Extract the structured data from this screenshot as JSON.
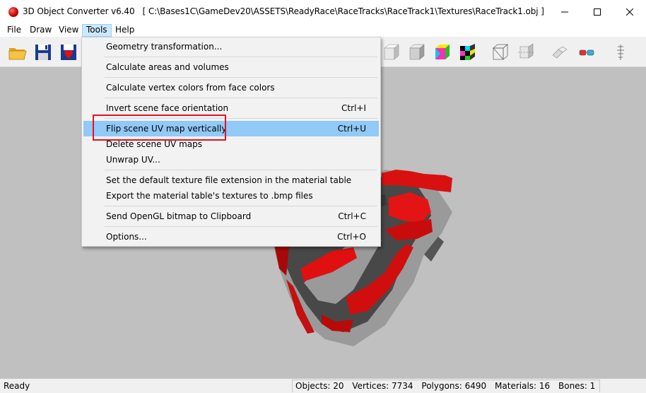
{
  "window": {
    "app_name": "3D Object Converter v6.40",
    "path": "[ C:\\Bases1C\\GameDev20\\ASSETS\\ReadyRace\\RaceTracks\\RaceTrack1\\Textures\\RaceTrack1.obj ]",
    "controls": [
      "minimize-icon",
      "maximize-icon",
      "close-icon"
    ]
  },
  "menubar": {
    "items": [
      {
        "label": "File"
      },
      {
        "label": "Draw"
      },
      {
        "label": "View"
      },
      {
        "label": "Tools",
        "active": true
      },
      {
        "label": "Help"
      }
    ]
  },
  "toolbar": {
    "icons": [
      "open-folder-icon",
      "save-icon",
      "save-as-icon",
      "white-cube-icon",
      "gray-cube-icon",
      "color-cube-icon",
      "checker-cube-icon",
      "wireframe-cube-icon",
      "flip-cube-icon",
      "rotate-object-icon",
      "glasses-icon",
      "spine-icon"
    ]
  },
  "tools_menu": {
    "groups": [
      [
        {
          "label": "Geometry transformation...",
          "shortcut": ""
        }
      ],
      [
        {
          "label": "Calculate areas and volumes",
          "shortcut": ""
        }
      ],
      [
        {
          "label": "Calculate vertex colors from face colors",
          "shortcut": ""
        }
      ],
      [
        {
          "label": "Invert scene face orientation",
          "shortcut": "Ctrl+I"
        }
      ],
      [
        {
          "label": "Flip scene UV map vertically",
          "shortcut": "Ctrl+U",
          "highlighted": true
        },
        {
          "label": "Delete scene UV maps",
          "shortcut": ""
        },
        {
          "label": "Unwrap UV...",
          "shortcut": ""
        }
      ],
      [
        {
          "label": "Set the default texture file extension in the material table",
          "shortcut": ""
        },
        {
          "label": "Export the material table's textures to .bmp files",
          "shortcut": ""
        }
      ],
      [
        {
          "label": "Send OpenGL bitmap to Clipboard",
          "shortcut": "Ctrl+C"
        }
      ],
      [
        {
          "label": "Options...",
          "shortcut": "Ctrl+O"
        }
      ]
    ]
  },
  "statusbar": {
    "state": "Ready",
    "objects": "Objects: 20",
    "vertices": "Vertices: 7734",
    "polygons": "Polygons: 6490",
    "materials": "Materials: 16",
    "bones": "Bones: 1"
  },
  "colors": {
    "viewport_bg": "#c0c0c0",
    "track_red": "#e01010",
    "track_dark": "#4a4a4a",
    "highlight": "#91c9f7",
    "annotation_red": "#e81123"
  }
}
